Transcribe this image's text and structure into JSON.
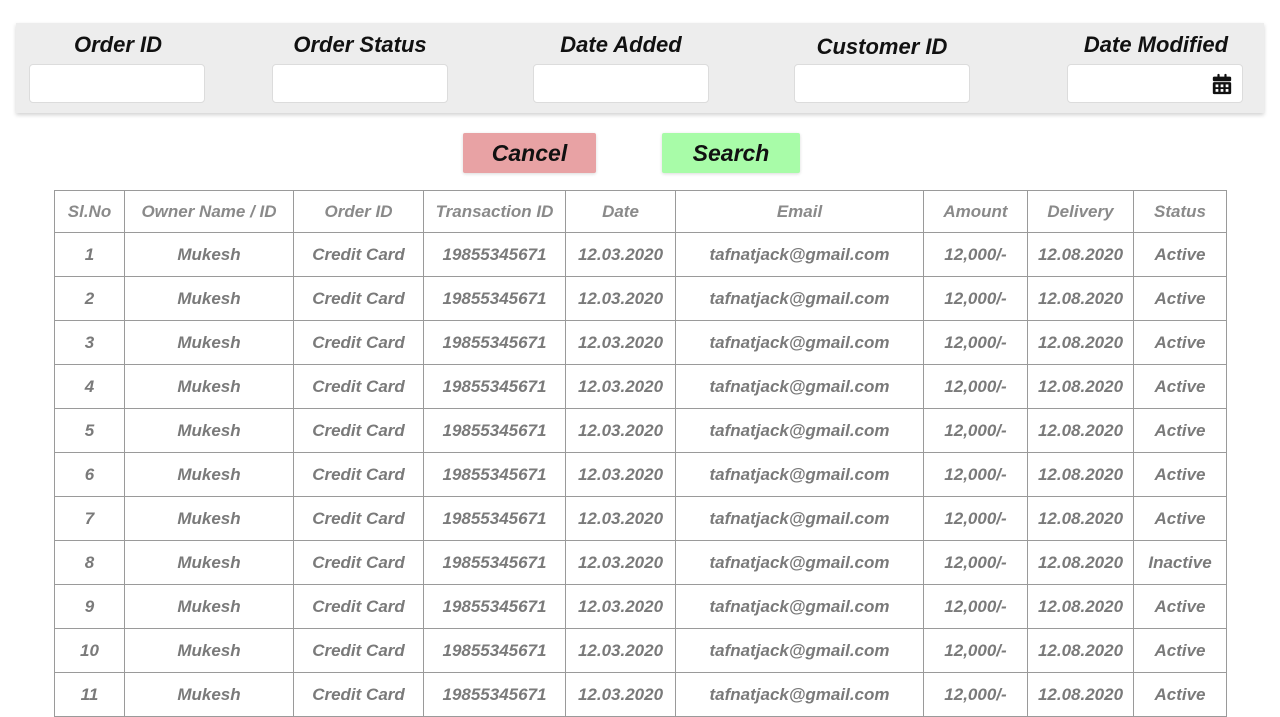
{
  "filters": [
    {
      "label": "Order ID",
      "value": ""
    },
    {
      "label": "Order Status",
      "value": ""
    },
    {
      "label": "Date Added",
      "value": ""
    },
    {
      "label": "Customer ID",
      "value": ""
    },
    {
      "label": "Date Modified",
      "value": "",
      "icon": "calendar-icon"
    }
  ],
  "buttons": {
    "cancel_label": "Cancel",
    "search_label": "Search",
    "cancel_color": "#e8a2a4",
    "search_color": "#a8fca8"
  },
  "table": {
    "columns": [
      "Sl.No",
      "Owner Name / ID",
      "Order ID",
      "Transaction ID",
      "Date",
      "Email",
      "Amount",
      "Delivery",
      "Status"
    ],
    "rows": [
      [
        "1",
        "Mukesh",
        "Credit Card",
        "19855345671",
        "12.03.2020",
        "tafnatjack@gmail.com",
        "12,000/-",
        "12.08.2020",
        "Active"
      ],
      [
        "2",
        "Mukesh",
        "Credit Card",
        "19855345671",
        "12.03.2020",
        "tafnatjack@gmail.com",
        "12,000/-",
        "12.08.2020",
        "Active"
      ],
      [
        "3",
        "Mukesh",
        "Credit Card",
        "19855345671",
        "12.03.2020",
        "tafnatjack@gmail.com",
        "12,000/-",
        "12.08.2020",
        "Active"
      ],
      [
        "4",
        "Mukesh",
        "Credit Card",
        "19855345671",
        "12.03.2020",
        "tafnatjack@gmail.com",
        "12,000/-",
        "12.08.2020",
        "Active"
      ],
      [
        "5",
        "Mukesh",
        "Credit Card",
        "19855345671",
        "12.03.2020",
        "tafnatjack@gmail.com",
        "12,000/-",
        "12.08.2020",
        "Active"
      ],
      [
        "6",
        "Mukesh",
        "Credit Card",
        "19855345671",
        "12.03.2020",
        "tafnatjack@gmail.com",
        "12,000/-",
        "12.08.2020",
        "Active"
      ],
      [
        "7",
        "Mukesh",
        "Credit Card",
        "19855345671",
        "12.03.2020",
        "tafnatjack@gmail.com",
        "12,000/-",
        "12.08.2020",
        "Active"
      ],
      [
        "8",
        "Mukesh",
        "Credit Card",
        "19855345671",
        "12.03.2020",
        "tafnatjack@gmail.com",
        "12,000/-",
        "12.08.2020",
        "Inactive"
      ],
      [
        "9",
        "Mukesh",
        "Credit Card",
        "19855345671",
        "12.03.2020",
        "tafnatjack@gmail.com",
        "12,000/-",
        "12.08.2020",
        "Active"
      ],
      [
        "10",
        "Mukesh",
        "Credit Card",
        "19855345671",
        "12.03.2020",
        "tafnatjack@gmail.com",
        "12,000/-",
        "12.08.2020",
        "Active"
      ],
      [
        "11",
        "Mukesh",
        "Credit Card",
        "19855345671",
        "12.03.2020",
        "tafnatjack@gmail.com",
        "12,000/-",
        "12.08.2020",
        "Active"
      ]
    ]
  }
}
